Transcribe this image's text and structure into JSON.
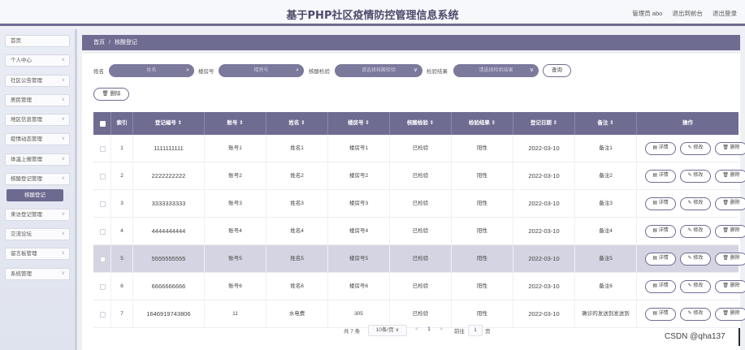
{
  "header": {
    "title": "基于PHP社区疫情防控管理信息系统",
    "admin": "管理员 abo",
    "to_frontend": "退出到前台",
    "logout": "退出登录"
  },
  "sidebar": {
    "items": [
      {
        "label": "首页",
        "chevron": false
      },
      {
        "label": "个人中心",
        "chevron": true
      },
      {
        "label": "社区公告管理",
        "chevron": true
      },
      {
        "label": "居民管理",
        "chevron": true
      },
      {
        "label": "地区信息管理",
        "chevron": true
      },
      {
        "label": "疫情动态管理",
        "chevron": true
      },
      {
        "label": "体温上报管理",
        "chevron": true
      },
      {
        "label": "核酸登记管理",
        "chevron": true
      },
      {
        "label": "核酸登记",
        "chevron": false,
        "active": true
      },
      {
        "label": "来访登记管理",
        "chevron": true
      },
      {
        "label": "交流论坛",
        "chevron": true
      },
      {
        "label": "留言板管理",
        "chevron": true
      },
      {
        "label": "系统管理",
        "chevron": true
      }
    ]
  },
  "breadcrumb": {
    "home": "首页",
    "separator": "/",
    "current": "核酸登记"
  },
  "search": {
    "name_label": "姓名",
    "name_placeholder": "姓名",
    "room_label": "楼房号",
    "room_placeholder": "楼房号",
    "test_label": "核酸检验",
    "test_placeholder": "请选择核酸检验",
    "result_label": "检验结果",
    "result_placeholder": "请选择检验结果",
    "query_button": "查询",
    "delete_button": "删除"
  },
  "table": {
    "headers": [
      "索引",
      "登记编号",
      "账号",
      "姓名",
      "楼房号",
      "核酸检验",
      "检验结果",
      "登记日期",
      "备注",
      "操作"
    ],
    "sort_mark": "⇕",
    "rows": [
      {
        "index": "1",
        "code": "1111111111",
        "account": "账号1",
        "name": "姓名1",
        "room": "楼房号1",
        "test": "已检验",
        "result": "阳性",
        "date": "2022-03-10",
        "note": "备注1"
      },
      {
        "index": "2",
        "code": "2222222222",
        "account": "账号2",
        "name": "姓名2",
        "room": "楼房号2",
        "test": "已检验",
        "result": "阳性",
        "date": "2022-03-10",
        "note": "备注2"
      },
      {
        "index": "3",
        "code": "3333333333",
        "account": "账号3",
        "name": "姓名3",
        "room": "楼房号3",
        "test": "已检验",
        "result": "阳性",
        "date": "2022-03-10",
        "note": "备注3"
      },
      {
        "index": "4",
        "code": "4444444444",
        "account": "账号4",
        "name": "姓名4",
        "room": "楼房号4",
        "test": "已检验",
        "result": "阳性",
        "date": "2022-03-10",
        "note": "备注4"
      },
      {
        "index": "5",
        "code": "5555555555",
        "account": "账号5",
        "name": "姓名5",
        "room": "楼房号5",
        "test": "已检验",
        "result": "阳性",
        "date": "2022-03-10",
        "note": "备注5",
        "highlighted": true
      },
      {
        "index": "6",
        "code": "6666666666",
        "account": "账号6",
        "name": "姓名6",
        "room": "楼房号6",
        "test": "已检验",
        "result": "阳性",
        "date": "2022-03-10",
        "note": "备注6"
      },
      {
        "index": "7",
        "code": "1646919743806",
        "account": "11",
        "name": "水电费",
        "room": "305",
        "test": "已检验",
        "result": "阳性",
        "date": "2022-03-10",
        "note": "确诊的发送到发送到"
      }
    ],
    "action_detail": "详情",
    "action_edit": "修改",
    "action_delete": "删除"
  },
  "pagination": {
    "total": "共 7 条",
    "page_size": "10条/页",
    "prev": "<",
    "current_page": "1",
    "next": ">",
    "goto_label": "前往",
    "goto_value": "1",
    "page_suffix": "页"
  },
  "watermark": "CSDN @qha137",
  "colors": {
    "accent": "#6f6c92",
    "highlight_row": "#d5d4e2"
  }
}
